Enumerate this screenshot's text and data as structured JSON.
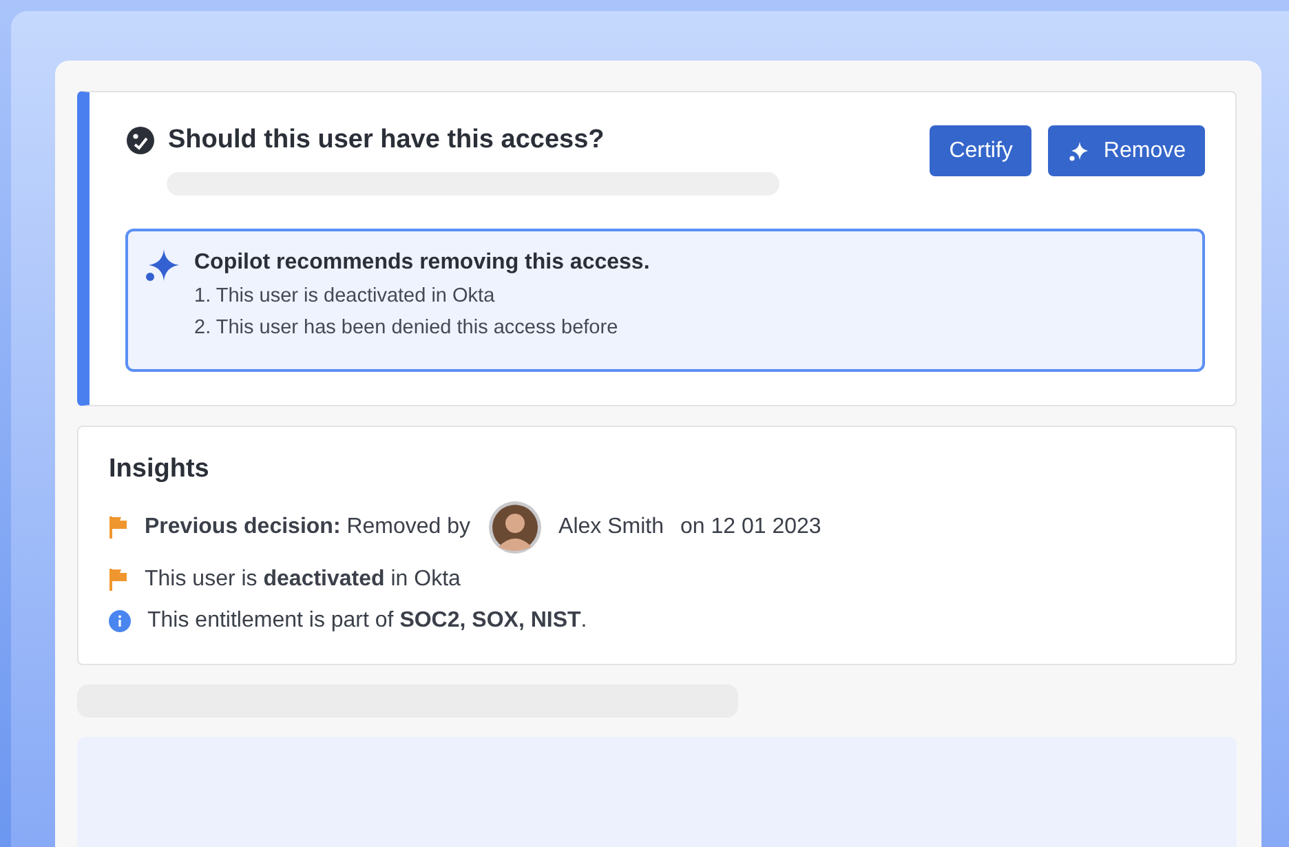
{
  "question": {
    "title": "Should this user have this access?"
  },
  "buttons": [
    {
      "label": "Certify",
      "kind": "plain"
    },
    {
      "label": "Remove",
      "kind": "sparkle"
    }
  ],
  "recommendation": {
    "title": "Copilot recommends removing this access.",
    "items": [
      "1. This user is deactivated in Okta",
      "2. This user has been denied this access before"
    ]
  },
  "insights": {
    "title": "Insights",
    "rows": [
      {
        "kind": "flag",
        "text": "**Previous decision:** Removed by",
        "person": "Alex Smith",
        "suffix": "on 12 01 2023"
      },
      {
        "kind": "flag",
        "text": "This user is **deactivated** in Okta"
      },
      {
        "kind": "info",
        "text": "This entitlement is part of **SOC2, SOX, NIST**."
      }
    ]
  }
}
